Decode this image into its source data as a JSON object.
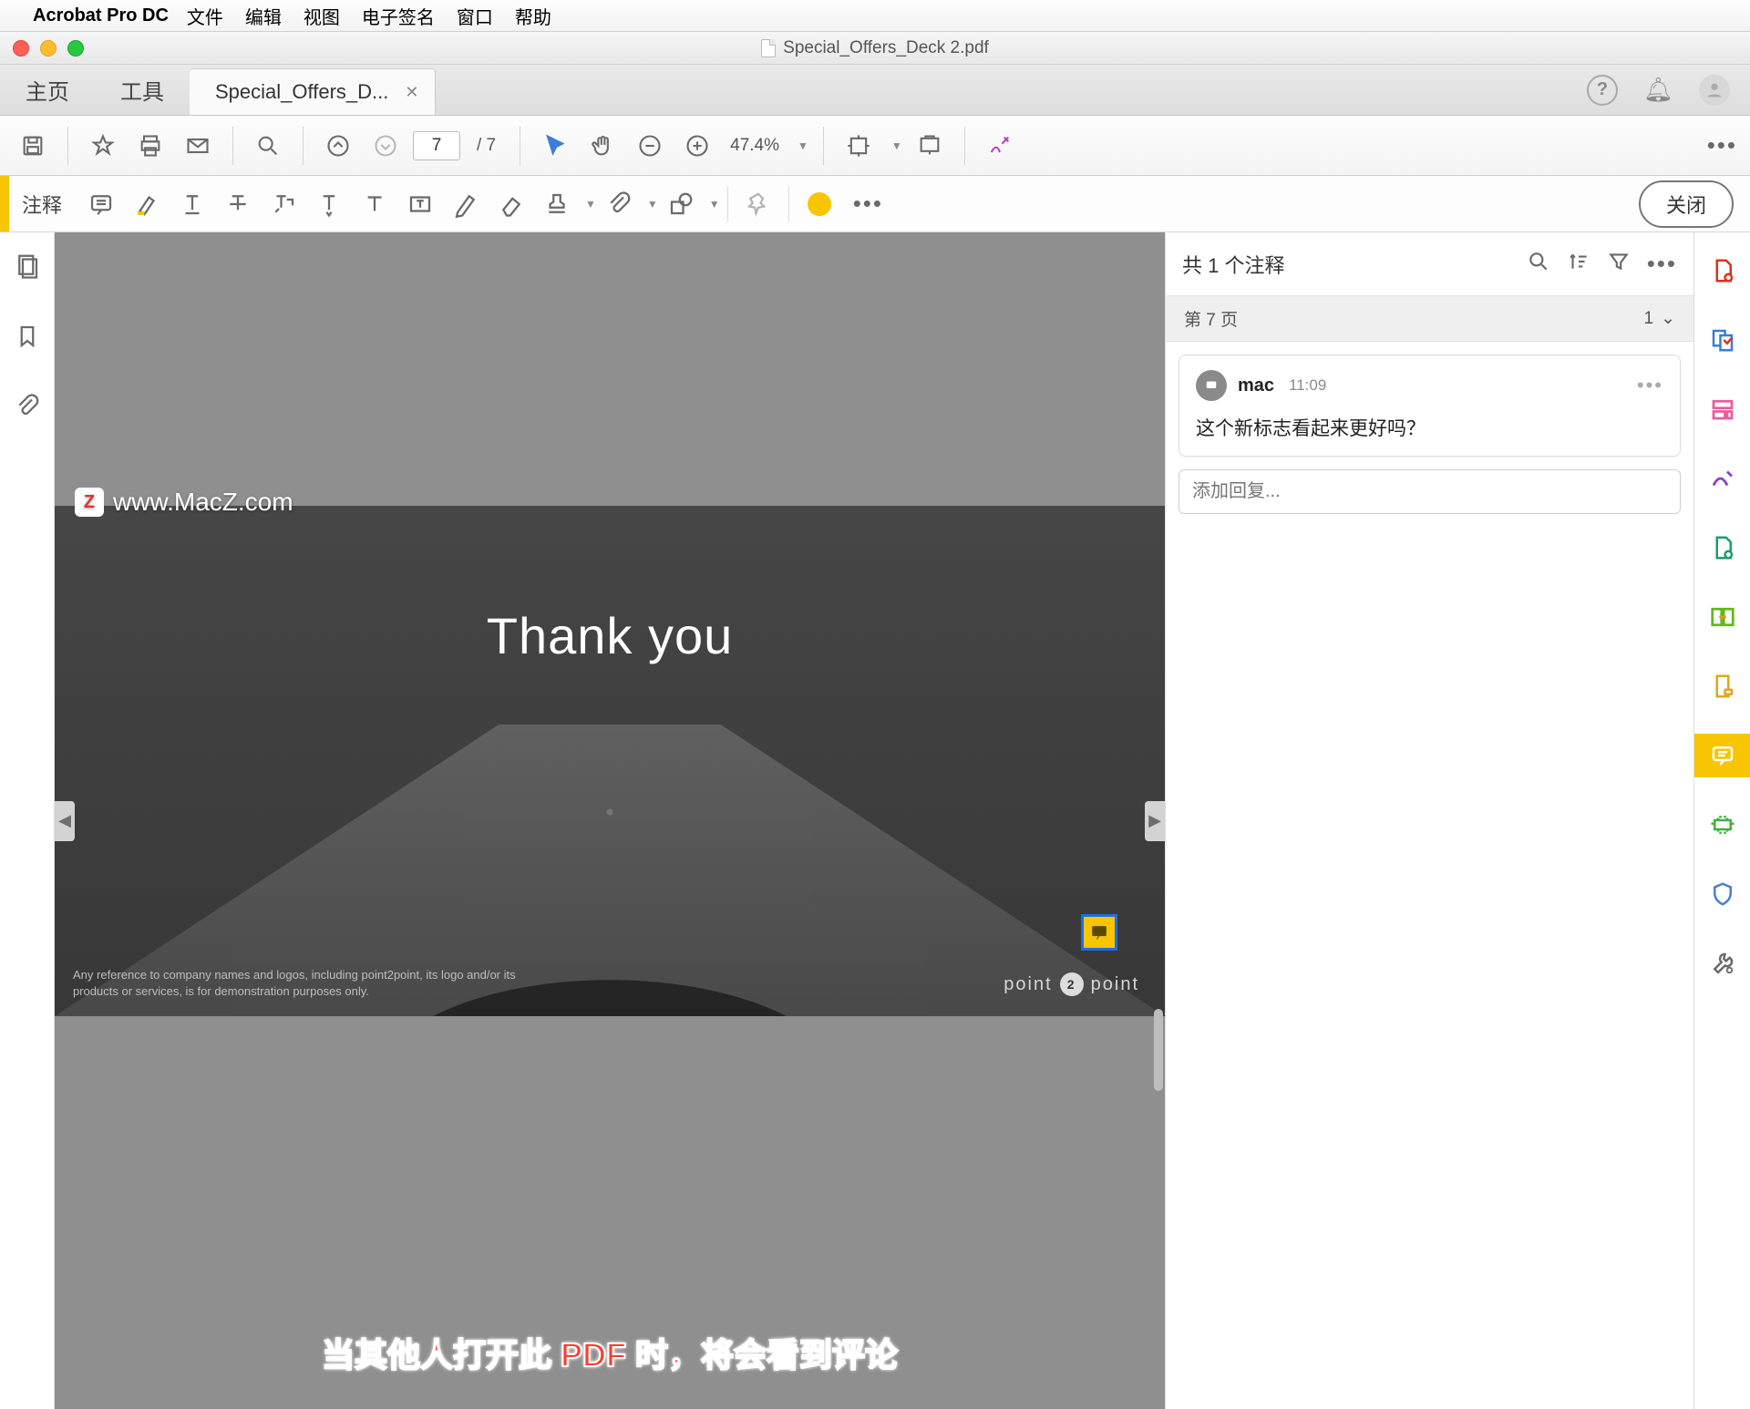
{
  "menubar": {
    "app": "Acrobat Pro DC",
    "items": [
      "文件",
      "编辑",
      "视图",
      "电子签名",
      "窗口",
      "帮助"
    ]
  },
  "window": {
    "title": "Special_Offers_Deck 2.pdf"
  },
  "tabs": {
    "home": "主页",
    "tools": "工具",
    "doc": "Special_Offers_D..."
  },
  "toolbar": {
    "page_current": "7",
    "page_total": "/ 7",
    "zoom": "47.4%"
  },
  "commentbar": {
    "label": "注释",
    "close": "关闭"
  },
  "comments_panel": {
    "header": "共 1 个注释",
    "page_label": "第 7 页",
    "page_count": "1",
    "item": {
      "user": "mac",
      "time": "11:09",
      "text": "这个新标志看起来更好吗？"
    },
    "reply_placeholder": "添加回复..."
  },
  "slide": {
    "title": "Thank you",
    "footnote": "Any reference to company names and logos, including point2point, its logo and/or its products or services, is for demonstration purposes only.",
    "brand_left": "point",
    "brand_mid": "2",
    "brand_right": "point"
  },
  "watermark": "www.MacZ.com",
  "caption": "当其他人打开此 PDF 时，将会看到评论"
}
